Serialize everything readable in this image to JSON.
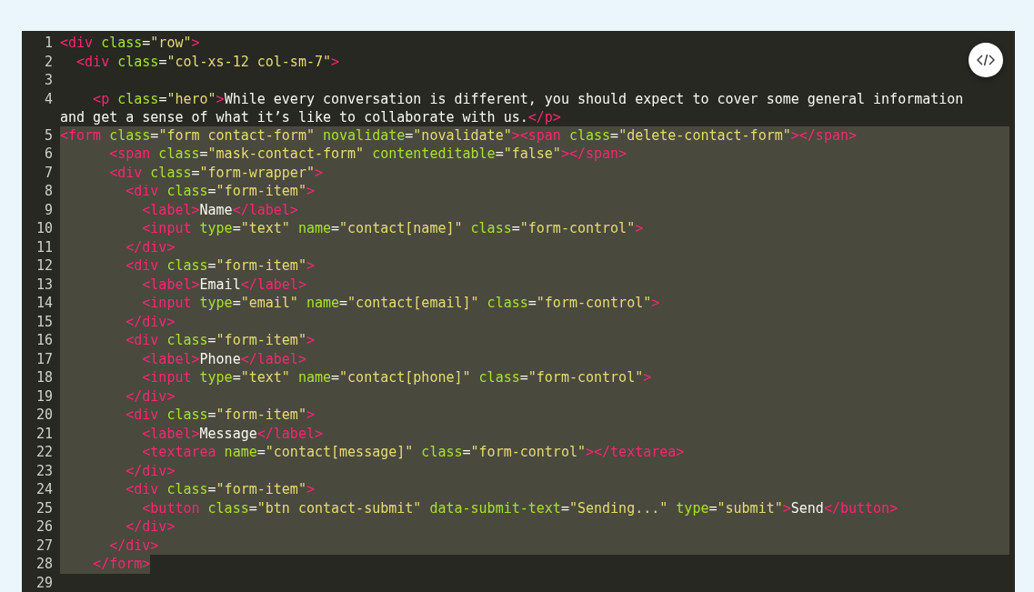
{
  "editor": {
    "lines": [
      {
        "number": "1",
        "kind": "plain",
        "tokens": [
          {
            "kind": "tag",
            "text": "<div"
          },
          {
            "kind": "attr",
            "text": " class"
          },
          {
            "kind": "punct",
            "text": "="
          },
          {
            "kind": "str",
            "text": "\"row\""
          },
          {
            "kind": "tag",
            "text": ">"
          }
        ]
      },
      {
        "number": "2",
        "kind": "plain",
        "tokens": [
          {
            "kind": "tag",
            "text": "  <div"
          },
          {
            "kind": "attr",
            "text": " class"
          },
          {
            "kind": "punct",
            "text": "="
          },
          {
            "kind": "str",
            "text": "\"col-xs-12 col-sm-7\""
          },
          {
            "kind": "tag",
            "text": ">"
          }
        ]
      },
      {
        "number": "3",
        "kind": "plain"
      },
      {
        "number": "4",
        "kind": "plain",
        "tokens": [
          {
            "kind": "tag",
            "text": "    <p"
          },
          {
            "kind": "attr",
            "text": " class"
          },
          {
            "kind": "punct",
            "text": "="
          },
          {
            "kind": "str",
            "text": "\"hero\""
          },
          {
            "kind": "tag",
            "text": ">"
          },
          {
            "kind": "text",
            "text": "While every conversation is different, you should expect to cover some general information"
          },
          {
            "kind": "break"
          },
          {
            "kind": "text",
            "text": "and get a sense of what it’s like to collaborate with us."
          },
          {
            "kind": "tag",
            "text": "</p>"
          }
        ]
      },
      {
        "number": "5",
        "kind": "selected_after_indent",
        "tokens": [
          {
            "kind": "tag",
            "text": "    <form"
          },
          {
            "kind": "attr",
            "text": " class"
          },
          {
            "kind": "punct",
            "text": "="
          },
          {
            "kind": "str",
            "text": "\"form contact-form\""
          },
          {
            "kind": "attr",
            "text": " novalidate"
          },
          {
            "kind": "punct",
            "text": "="
          },
          {
            "kind": "str",
            "text": "\"novalidate\""
          },
          {
            "kind": "tag",
            "text": "><span"
          },
          {
            "kind": "attr",
            "text": " class"
          },
          {
            "kind": "punct",
            "text": "="
          },
          {
            "kind": "str",
            "text": "\"delete-contact-form\""
          },
          {
            "kind": "tag",
            "text": "></span>"
          }
        ]
      },
      {
        "number": "6",
        "kind": "selected",
        "tokens": [
          {
            "kind": "tag",
            "text": "      <span"
          },
          {
            "kind": "attr",
            "text": " class"
          },
          {
            "kind": "punct",
            "text": "="
          },
          {
            "kind": "str",
            "text": "\"mask-contact-form\""
          },
          {
            "kind": "attr",
            "text": " contenteditable"
          },
          {
            "kind": "punct",
            "text": "="
          },
          {
            "kind": "str",
            "text": "\"false\""
          },
          {
            "kind": "tag",
            "text": "></span>"
          }
        ]
      },
      {
        "number": "7",
        "kind": "selected",
        "tokens": [
          {
            "kind": "tag",
            "text": "      <div"
          },
          {
            "kind": "attr",
            "text": " class"
          },
          {
            "kind": "punct",
            "text": "="
          },
          {
            "kind": "str",
            "text": "\"form-wrapper\""
          },
          {
            "kind": "tag",
            "text": ">"
          }
        ]
      },
      {
        "number": "8",
        "kind": "selected",
        "tokens": [
          {
            "kind": "tag",
            "text": "        <div"
          },
          {
            "kind": "attr",
            "text": " class"
          },
          {
            "kind": "punct",
            "text": "="
          },
          {
            "kind": "str",
            "text": "\"form-item\""
          },
          {
            "kind": "tag",
            "text": ">"
          }
        ]
      },
      {
        "number": "9",
        "kind": "selected",
        "tokens": [
          {
            "kind": "tag",
            "text": "          <label>"
          },
          {
            "kind": "text",
            "text": "Name"
          },
          {
            "kind": "tag",
            "text": "</label>"
          }
        ]
      },
      {
        "number": "10",
        "kind": "selected",
        "tokens": [
          {
            "kind": "tag",
            "text": "          <input"
          },
          {
            "kind": "attr",
            "text": " type"
          },
          {
            "kind": "punct",
            "text": "="
          },
          {
            "kind": "str",
            "text": "\"text\""
          },
          {
            "kind": "attr",
            "text": " name"
          },
          {
            "kind": "punct",
            "text": "="
          },
          {
            "kind": "str",
            "text": "\"contact[name]\""
          },
          {
            "kind": "attr",
            "text": " class"
          },
          {
            "kind": "punct",
            "text": "="
          },
          {
            "kind": "str",
            "text": "\"form-control\""
          },
          {
            "kind": "tag",
            "text": ">"
          }
        ]
      },
      {
        "number": "11",
        "kind": "selected",
        "tokens": [
          {
            "kind": "tag",
            "text": "        </div>"
          }
        ]
      },
      {
        "number": "12",
        "kind": "selected",
        "tokens": [
          {
            "kind": "tag",
            "text": "        <div"
          },
          {
            "kind": "attr",
            "text": " class"
          },
          {
            "kind": "punct",
            "text": "="
          },
          {
            "kind": "str",
            "text": "\"form-item\""
          },
          {
            "kind": "tag",
            "text": ">"
          }
        ]
      },
      {
        "number": "13",
        "kind": "selected",
        "tokens": [
          {
            "kind": "tag",
            "text": "          <label>"
          },
          {
            "kind": "text",
            "text": "Email"
          },
          {
            "kind": "tag",
            "text": "</label>"
          }
        ]
      },
      {
        "number": "14",
        "kind": "selected",
        "tokens": [
          {
            "kind": "tag",
            "text": "          <input"
          },
          {
            "kind": "attr",
            "text": " type"
          },
          {
            "kind": "punct",
            "text": "="
          },
          {
            "kind": "str",
            "text": "\"email\""
          },
          {
            "kind": "attr",
            "text": " name"
          },
          {
            "kind": "punct",
            "text": "="
          },
          {
            "kind": "str",
            "text": "\"contact[email]\""
          },
          {
            "kind": "attr",
            "text": " class"
          },
          {
            "kind": "punct",
            "text": "="
          },
          {
            "kind": "str",
            "text": "\"form-control\""
          },
          {
            "kind": "tag",
            "text": ">"
          }
        ]
      },
      {
        "number": "15",
        "kind": "selected",
        "tokens": [
          {
            "kind": "tag",
            "text": "        </div>"
          }
        ]
      },
      {
        "number": "16",
        "kind": "selected",
        "tokens": [
          {
            "kind": "tag",
            "text": "        <div"
          },
          {
            "kind": "attr",
            "text": " class"
          },
          {
            "kind": "punct",
            "text": "="
          },
          {
            "kind": "str",
            "text": "\"form-item\""
          },
          {
            "kind": "tag",
            "text": ">"
          }
        ]
      },
      {
        "number": "17",
        "kind": "selected",
        "tokens": [
          {
            "kind": "tag",
            "text": "          <label>"
          },
          {
            "kind": "text",
            "text": "Phone"
          },
          {
            "kind": "tag",
            "text": "</label>"
          }
        ]
      },
      {
        "number": "18",
        "kind": "selected",
        "tokens": [
          {
            "kind": "tag",
            "text": "          <input"
          },
          {
            "kind": "attr",
            "text": " type"
          },
          {
            "kind": "punct",
            "text": "="
          },
          {
            "kind": "str",
            "text": "\"text\""
          },
          {
            "kind": "attr",
            "text": " name"
          },
          {
            "kind": "punct",
            "text": "="
          },
          {
            "kind": "str",
            "text": "\"contact[phone]\""
          },
          {
            "kind": "attr",
            "text": " class"
          },
          {
            "kind": "punct",
            "text": "="
          },
          {
            "kind": "str",
            "text": "\"form-control\""
          },
          {
            "kind": "tag",
            "text": ">"
          }
        ]
      },
      {
        "number": "19",
        "kind": "selected",
        "tokens": [
          {
            "kind": "tag",
            "text": "        </div>"
          }
        ]
      },
      {
        "number": "20",
        "kind": "selected",
        "tokens": [
          {
            "kind": "tag",
            "text": "        <div"
          },
          {
            "kind": "attr",
            "text": " class"
          },
          {
            "kind": "punct",
            "text": "="
          },
          {
            "kind": "str",
            "text": "\"form-item\""
          },
          {
            "kind": "tag",
            "text": ">"
          }
        ]
      },
      {
        "number": "21",
        "kind": "selected",
        "tokens": [
          {
            "kind": "tag",
            "text": "          <label>"
          },
          {
            "kind": "text",
            "text": "Message"
          },
          {
            "kind": "tag",
            "text": "</label>"
          }
        ]
      },
      {
        "number": "22",
        "kind": "selected",
        "tokens": [
          {
            "kind": "tag",
            "text": "          <textarea"
          },
          {
            "kind": "attr",
            "text": " name"
          },
          {
            "kind": "punct",
            "text": "="
          },
          {
            "kind": "str",
            "text": "\"contact[message]\""
          },
          {
            "kind": "attr",
            "text": " class"
          },
          {
            "kind": "punct",
            "text": "="
          },
          {
            "kind": "str",
            "text": "\"form-control\""
          },
          {
            "kind": "tag",
            "text": "></textarea>"
          }
        ]
      },
      {
        "number": "23",
        "kind": "selected",
        "tokens": [
          {
            "kind": "tag",
            "text": "        </div>"
          }
        ]
      },
      {
        "number": "24",
        "kind": "selected",
        "tokens": [
          {
            "kind": "tag",
            "text": "        <div"
          },
          {
            "kind": "attr",
            "text": " class"
          },
          {
            "kind": "punct",
            "text": "="
          },
          {
            "kind": "str",
            "text": "\"form-item\""
          },
          {
            "kind": "tag",
            "text": ">"
          }
        ]
      },
      {
        "number": "25",
        "kind": "selected",
        "tokens": [
          {
            "kind": "tag",
            "text": "          <button"
          },
          {
            "kind": "attr",
            "text": " class"
          },
          {
            "kind": "punct",
            "text": "="
          },
          {
            "kind": "str",
            "text": "\"btn contact-submit\""
          },
          {
            "kind": "attr",
            "text": " data-submit-text"
          },
          {
            "kind": "punct",
            "text": "="
          },
          {
            "kind": "str",
            "text": "\"Sending...\""
          },
          {
            "kind": "attr",
            "text": " type"
          },
          {
            "kind": "punct",
            "text": "="
          },
          {
            "kind": "str",
            "text": "\"submit\""
          },
          {
            "kind": "tag",
            "text": ">"
          },
          {
            "kind": "text",
            "text": "Send"
          },
          {
            "kind": "tag",
            "text": "</button>"
          }
        ]
      },
      {
        "number": "26",
        "kind": "selected",
        "tokens": [
          {
            "kind": "tag",
            "text": "        </div>"
          }
        ]
      },
      {
        "number": "27",
        "kind": "selected",
        "tokens": [
          {
            "kind": "tag",
            "text": "      </div>"
          }
        ]
      },
      {
        "number": "28",
        "kind": "selected_to_end",
        "tokens": [
          {
            "kind": "tag",
            "text": "    </form>"
          }
        ]
      },
      {
        "number": "29",
        "kind": "plain"
      }
    ]
  }
}
